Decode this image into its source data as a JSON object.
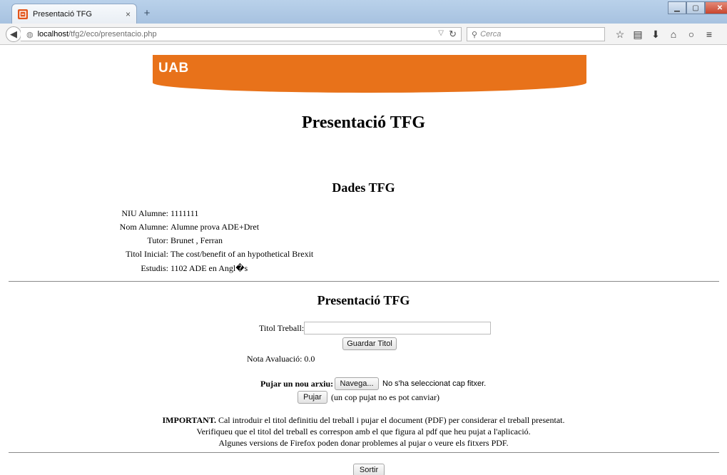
{
  "browser": {
    "tab_favicon": "UAB",
    "tab_title": "Presentació TFG",
    "tab_close": "×",
    "new_tab": "+",
    "url_host": "localhost",
    "url_path": "/tfg2/eco/presentacio.php",
    "search_placeholder": "Cerca",
    "icons": [
      "star-icon",
      "reading-list-icon",
      "download-icon",
      "home-icon",
      "chat-icon",
      "menu-icon"
    ],
    "window_controls": [
      "minimize",
      "maximize",
      "close"
    ]
  },
  "banner": {
    "logo": "UAB",
    "color": "#e8721a"
  },
  "page_title": "Presentació TFG",
  "dades": {
    "heading": "Dades TFG",
    "fields": [
      {
        "label": "NIU Alumne:",
        "value": "1111111"
      },
      {
        "label": "Nom Alumne:",
        "value": "Alumne prova ADE+Dret"
      },
      {
        "label": "Tutor:",
        "value": "Brunet , Ferran"
      },
      {
        "label": "Titol Inicial:",
        "value": "The cost/benefit of an hypothetical Brexit"
      },
      {
        "label": "Estudis:",
        "value": "1102 ADE en Angl�s"
      }
    ]
  },
  "presentacio": {
    "heading": "Presentació TFG",
    "titol_label": "Titol Treball:",
    "titol_value": "",
    "guardar_button": "Guardar Titol",
    "nota_label": "Nota Avaluació:",
    "nota_value": "0.0",
    "upload_label": "Pujar un nou arxiu:",
    "browse_button": "Navega...",
    "no_file_text": "No s'ha seleccionat cap fitxer.",
    "pujar_button": "Pujar",
    "pujar_note": "(un cop pujat no es pot canviar)"
  },
  "notes": {
    "important": "IMPORTANT.",
    "line1": "Cal introduir el titol definitiu del treball i pujar el document (PDF) per considerar el treball presentat.",
    "line2": "Verifiqueu que el titol del treball es correspon amb el que figura al pdf que heu pujat a l'aplicació.",
    "line3": "Algunes versions de Firefox poden donar problemes al pujar o veure els fitxers PDF."
  },
  "sortir_button": "Sortir"
}
